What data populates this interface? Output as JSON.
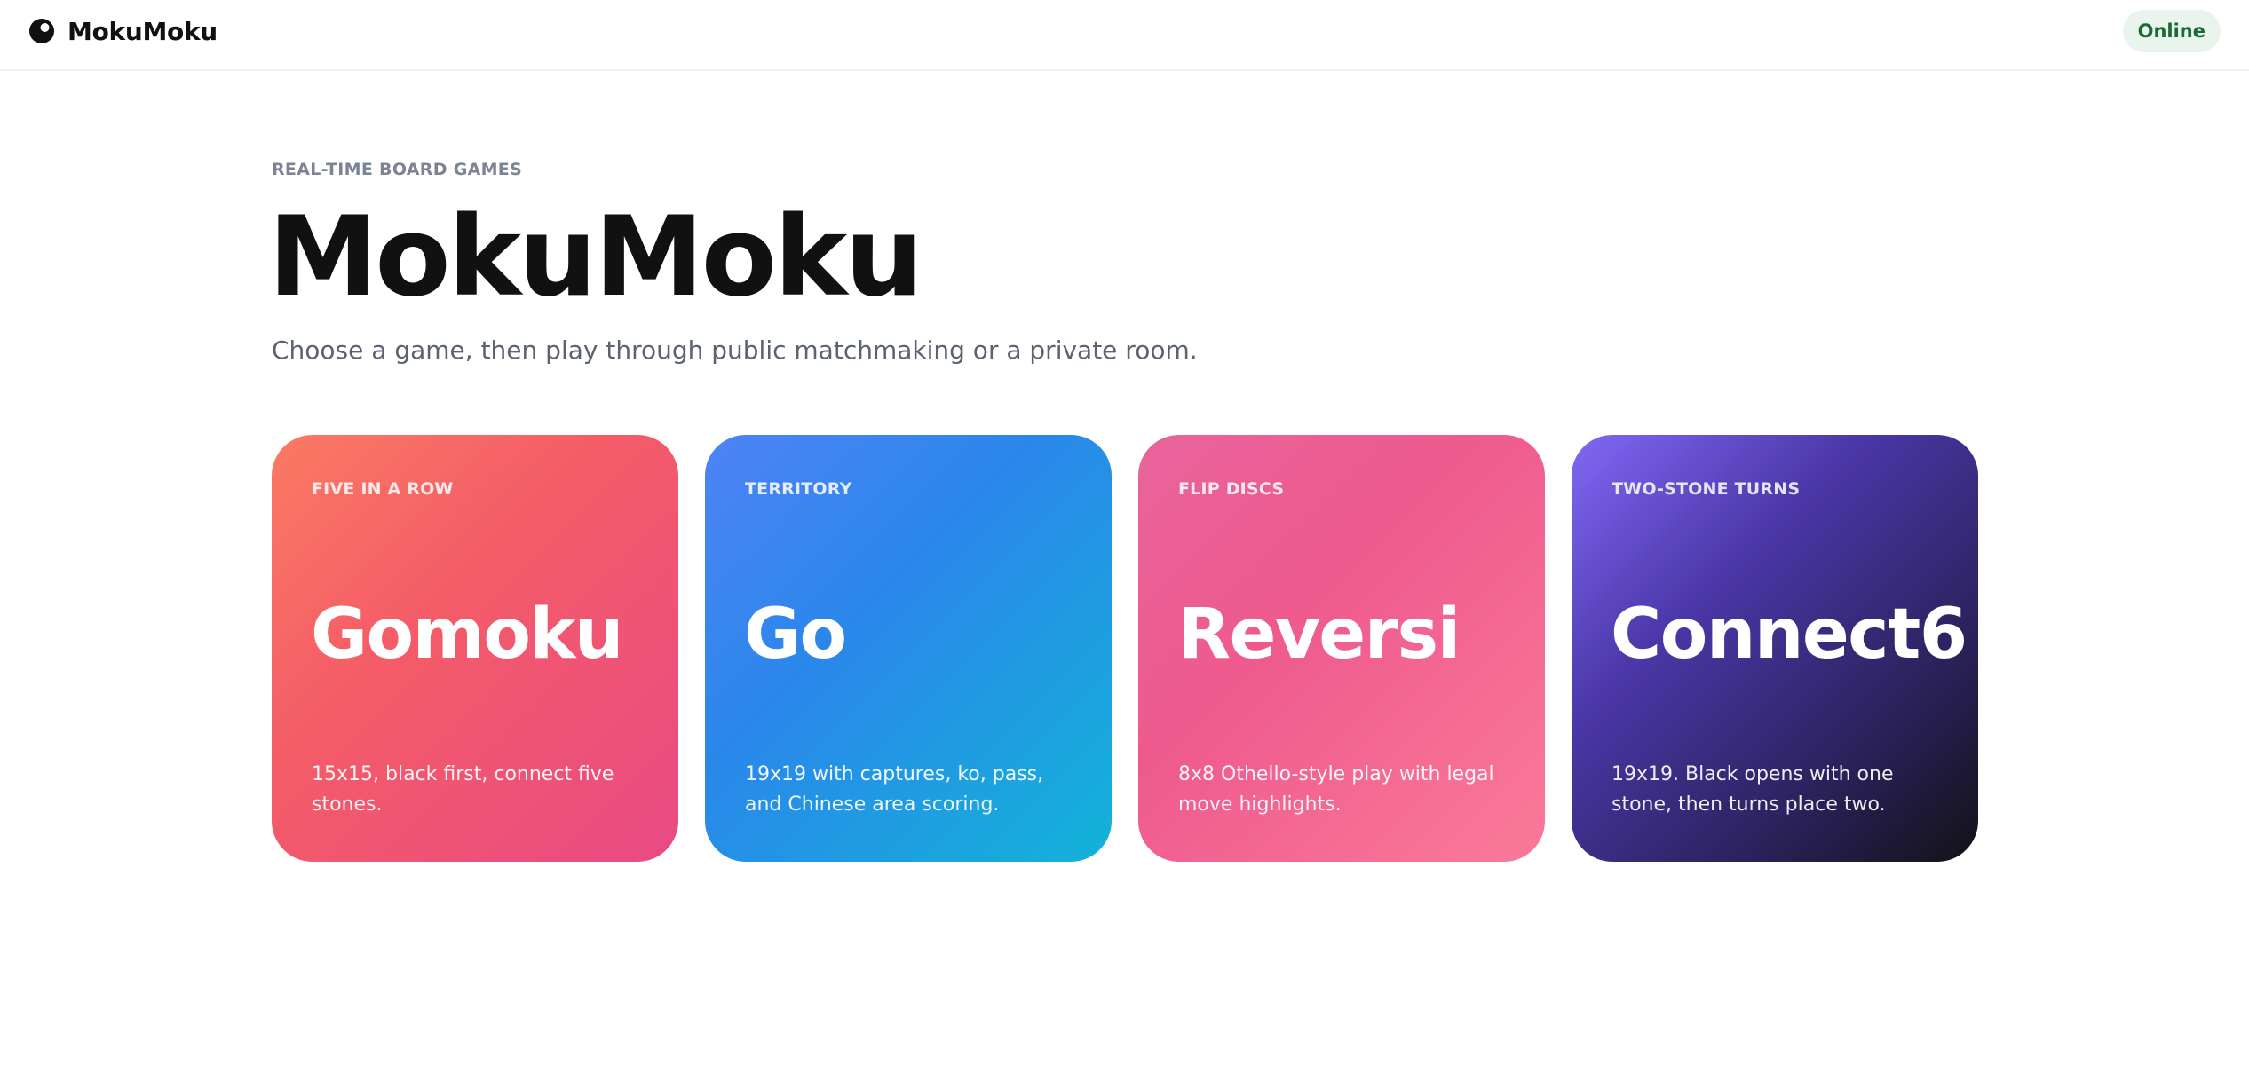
{
  "header": {
    "brand_name": "MokuMoku",
    "status_label": "Online",
    "colors": {
      "status_bg": "#e9f5ec",
      "status_text": "#1a6b34"
    }
  },
  "hero": {
    "eyebrow": "REAL-TIME BOARD GAMES",
    "title": "MokuMoku",
    "subtitle": "Choose a game, then play through public matchmaking or a private room."
  },
  "games": [
    {
      "eyebrow": "FIVE IN A ROW",
      "title": "Gomoku",
      "description": "15x15, black first, connect five stones.",
      "colors": [
        "#fb7a63",
        "#f45c67",
        "#e84a85"
      ]
    },
    {
      "eyebrow": "TERRITORY",
      "title": "Go",
      "description": "19x19 with captures, ko, pass, and Chinese area scoring.",
      "colors": [
        "#4f83f6",
        "#2a87ea",
        "#13b3d8"
      ]
    },
    {
      "eyebrow": "FLIP DISCS",
      "title": "Reversi",
      "description": "8x8 Othello-style play with legal move highlights.",
      "colors": [
        "#e8649c",
        "#ee5a8d",
        "#fa7a9a"
      ]
    },
    {
      "eyebrow": "TWO-STONE TURNS",
      "title": "Connect6",
      "description": "19x19. Black opens with one stone, then turns place two.",
      "colors": [
        "#8168f5",
        "#2c2360",
        "#121216"
      ]
    }
  ]
}
